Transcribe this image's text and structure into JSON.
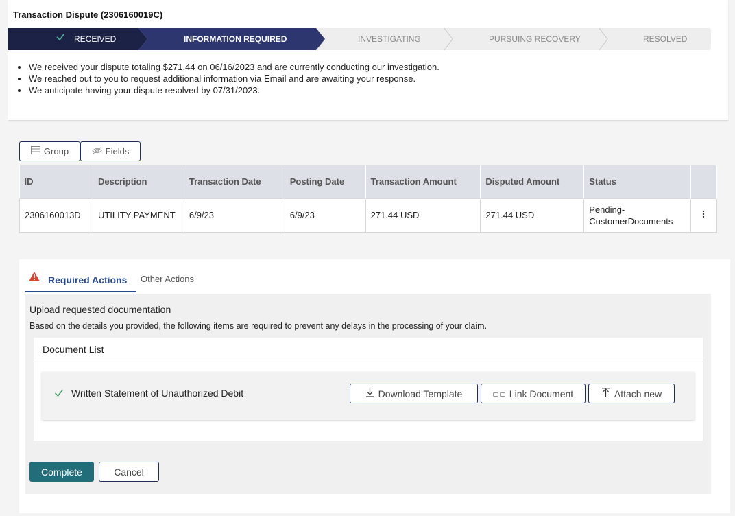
{
  "header": {
    "title": "Transaction Dispute (2306160019C)"
  },
  "stepper": {
    "steps": [
      {
        "label": "RECEIVED",
        "state": "complete"
      },
      {
        "label": "INFORMATION REQUIRED",
        "state": "current"
      },
      {
        "label": "INVESTIGATING",
        "state": "pending"
      },
      {
        "label": "PURSUING RECOVERY",
        "state": "pending"
      },
      {
        "label": "RESOLVED",
        "state": "pending"
      }
    ],
    "colors": {
      "complete": "#1b2245",
      "current": "#2e3670",
      "pending": "#eeeeee"
    }
  },
  "summary": {
    "lines": [
      "We received your dispute totaling $271.44 on 06/16/2023 and are currently conducting our investigation.",
      "We reached out to you to request additional information via Email and are awaiting your response.",
      "We anticipate having your dispute resolved by 07/31/2023."
    ]
  },
  "toolbar": {
    "group_label": "Group",
    "fields_label": "Fields"
  },
  "table": {
    "headers": [
      "ID",
      "Description",
      "Transaction Date",
      "Posting Date",
      "Transaction Amount",
      "Disputed Amount",
      "Status"
    ],
    "rows": [
      [
        "2306160013D",
        "UTILITY PAYMENT",
        "6/9/23",
        "6/9/23",
        "271.44 USD",
        "271.44 USD",
        "Pending-CustomerDocuments"
      ]
    ]
  },
  "actions": {
    "tabs": {
      "required": "Required Actions",
      "other": "Other Actions"
    },
    "upload_title": "Upload requested documentation",
    "upload_desc": "Based on the details you provided, the following items are required to prevent any delays in the processing of your claim.",
    "document_list_title": "Document List",
    "document": {
      "name": "Written Statement of Unauthorized Debit",
      "download_label": "Download Template",
      "link_label": "Link Document",
      "attach_label": "Attach new"
    },
    "complete_label": "Complete",
    "cancel_label": "Cancel"
  },
  "colors": {
    "accent": "#2b4a8b",
    "complete_button": "#226d7a",
    "warning": "#d9432f",
    "check": "#3c9a5f"
  }
}
